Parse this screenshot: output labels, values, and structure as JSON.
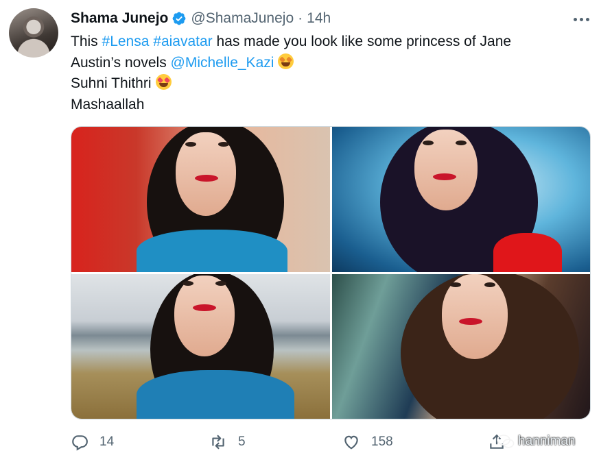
{
  "tweet": {
    "author_name": "Shama Junejo",
    "handle": "@ShamaJunejo",
    "separator": "·",
    "time": "14h",
    "text": {
      "l1_prefix": "This ",
      "tag1": "#Lensa",
      "space": " ",
      "tag2": "#aiavatar",
      "l1_suffix": " has made you look like some princess of Jane",
      "l2_prefix": "Austin’s novels ",
      "mention": "@Michelle_Kazi",
      "l3": "Suhni Thithri",
      "l4": "Mashaallah"
    },
    "actions": {
      "replies": "14",
      "retweets": "5",
      "likes": "158"
    }
  },
  "watermark": {
    "text": "hanniman"
  },
  "icons": {
    "verified": "verified-badge-icon",
    "more": "more-dots-icon",
    "reply": "reply-icon",
    "retweet": "retweet-icon",
    "like": "heart-icon",
    "share": "share-icon",
    "watermark": "wechat-icon"
  },
  "colors": {
    "link": "#1d9bf0",
    "verified": "#1d9bf0",
    "muted": "#536471",
    "text": "#0f1419"
  }
}
